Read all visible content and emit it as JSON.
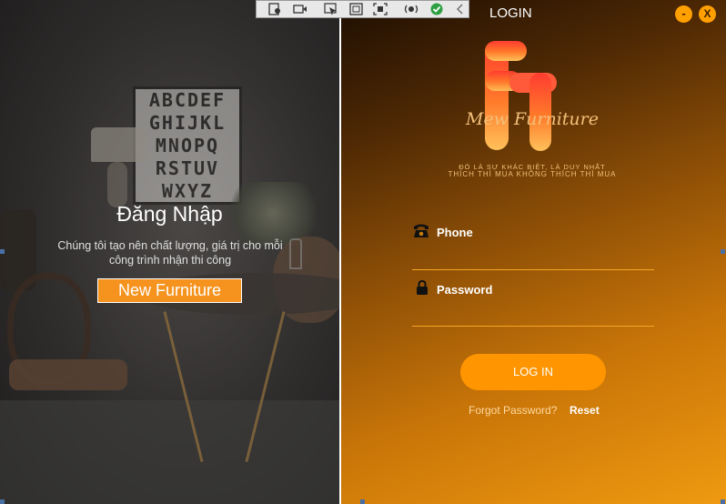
{
  "window": {
    "title": "LOGIN",
    "minimize_label": "-",
    "close_label": "X"
  },
  "left_panel": {
    "title": "Đăng Nhập",
    "subtitle": "Chúng tôi tạo nên chất lượng, giá trị cho mỗi công trình nhận thi công",
    "button_label": "New Furniture",
    "poster_letters": [
      "ABCDEF",
      "GHIJKL",
      "MNOPQ",
      "RSTUV",
      "WXYZ"
    ]
  },
  "brand": {
    "name": "Mew Furniture",
    "slogan_line1": "ĐÓ LÀ SỰ KHÁC BIỆT, LÀ DUY NHẤT",
    "slogan_line2": "THÍCH THÌ MUA KHÔNG THÍCH THÌ MUA"
  },
  "form": {
    "phone_label": "Phone",
    "phone_value": "",
    "password_label": "Password",
    "password_value": "",
    "login_label": "LOG IN",
    "forgot_label": "Forgot Password?",
    "reset_label": "Reset"
  },
  "colors": {
    "accent": "#ff9500",
    "gradient_dark": "#1e0e02",
    "gradient_light": "#ef9a10",
    "left_button": "#f5931e"
  },
  "icons": [
    "phone-icon",
    "lock-icon",
    "minimize-icon",
    "close-icon"
  ]
}
